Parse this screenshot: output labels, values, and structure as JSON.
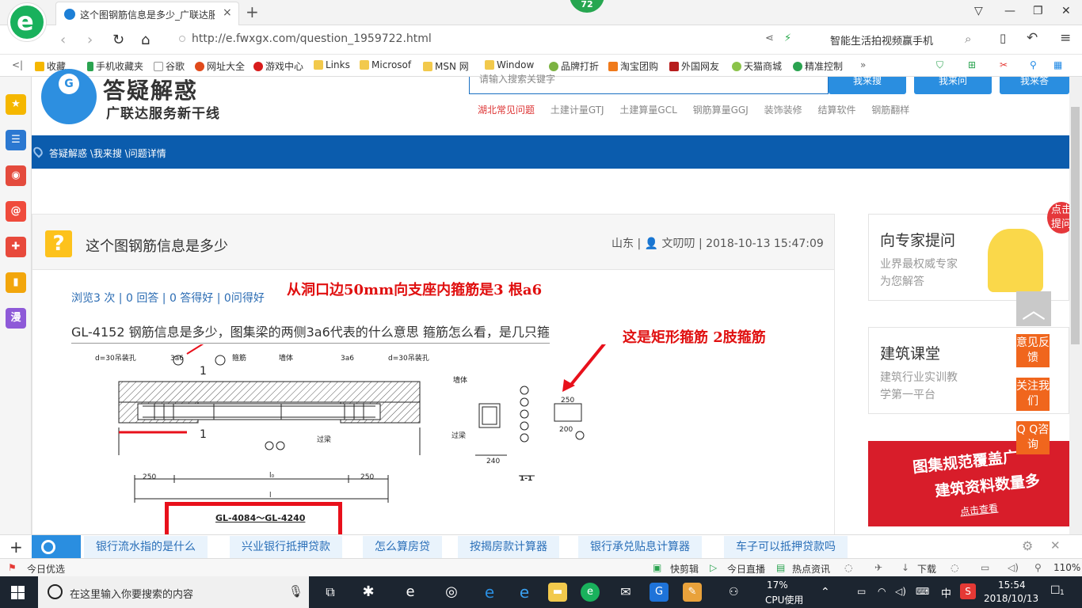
{
  "tab": {
    "title": "这个图钢筋信息是多少_广联达服务新干线",
    "close": "×",
    "new": "+"
  },
  "badge": "72",
  "window_buttons": [
    "▽",
    "—",
    "❐",
    "✕"
  ],
  "address": {
    "url": "http://e.fwxgx.com/question_1959722.html",
    "right_text": "智能生活拍视频赢手机"
  },
  "bookmarks": [
    "收藏",
    "手机收藏夹",
    "谷歌",
    "网址大全",
    "游戏中心",
    "Links",
    "Microsof",
    "MSN 网",
    "Window",
    "品牌打折",
    "淘宝团购",
    "外国网友",
    "天猫商城",
    "精准控制"
  ],
  "sidebar_icon_names": [
    "star-icon",
    "news-icon",
    "weibo-icon",
    "mail-icon",
    "game-icon",
    "book-icon",
    "manga-icon"
  ],
  "sidebar_label_manga": "漫",
  "header": {
    "logo_big": "答疑解惑",
    "logo_sub": "广联达服务新干线",
    "search_placeholder": "请输入搜索关键字",
    "btn_search": "我来搜",
    "btn_ask": "我来问",
    "btn_answer": "我来答",
    "categories": [
      "湖北常见问题",
      "土建计量GTJ",
      "土建算量GCL",
      "钢筋算量GGJ",
      "装饰装修",
      "结算软件",
      "钢筋翻样"
    ]
  },
  "breadcrumb": "答疑解惑 \\我来搜 \\问题详情",
  "question": {
    "icon": "?",
    "title": "这个图钢筋信息是多少",
    "meta": "山东 | 👤 文叨叨 | 2018-10-13 15:47:09",
    "stats": "浏览3 次 | 0 回答 | 0 答得好 | 0问得好",
    "text": "GL-4152 钢筋信息是多少，图集梁的两侧3a6代表的什么意思 箍筋怎么看，是几只箍",
    "annotation_1": "从洞口边50mm向支座内箍筋是3 根a6",
    "annotation_2": "这是矩形箍筋 2肢箍筋",
    "drawing_code": "GL-4084～GL-4240"
  },
  "right": {
    "expert_title": "向专家提问",
    "expert_sub1": "业界最权威专家",
    "expert_sub2": "为您解答",
    "course_title": "建筑课堂",
    "course_sub1": "建筑行业实训教",
    "course_sub2": "学第一平台",
    "ad_line1": "图集规范覆盖广",
    "ad_line2": "建筑资料数量多",
    "ad_line3": "点击查看",
    "float_1": "意见反馈",
    "float_2": "关注我们",
    "float_3": "Q Q咨询",
    "click_ask": "点击提问"
  },
  "news": [
    "银行流水指的是什么",
    "兴业银行抵押贷款",
    "怎么算房贷",
    "按揭房款计算器",
    "银行承兑贴息计算器",
    "车子可以抵押贷款吗"
  ],
  "status": {
    "left": "今日优选",
    "items": [
      "快剪辑",
      "今日直播",
      "热点资讯",
      "下载"
    ],
    "zoom": "110%"
  },
  "taskbar": {
    "search": "在这里输入你要搜索的内容",
    "cpu": "17%",
    "cpu_label": "CPU使用",
    "ime": "中",
    "time": "15:54",
    "date": "2018/10/13",
    "notif": "1"
  }
}
